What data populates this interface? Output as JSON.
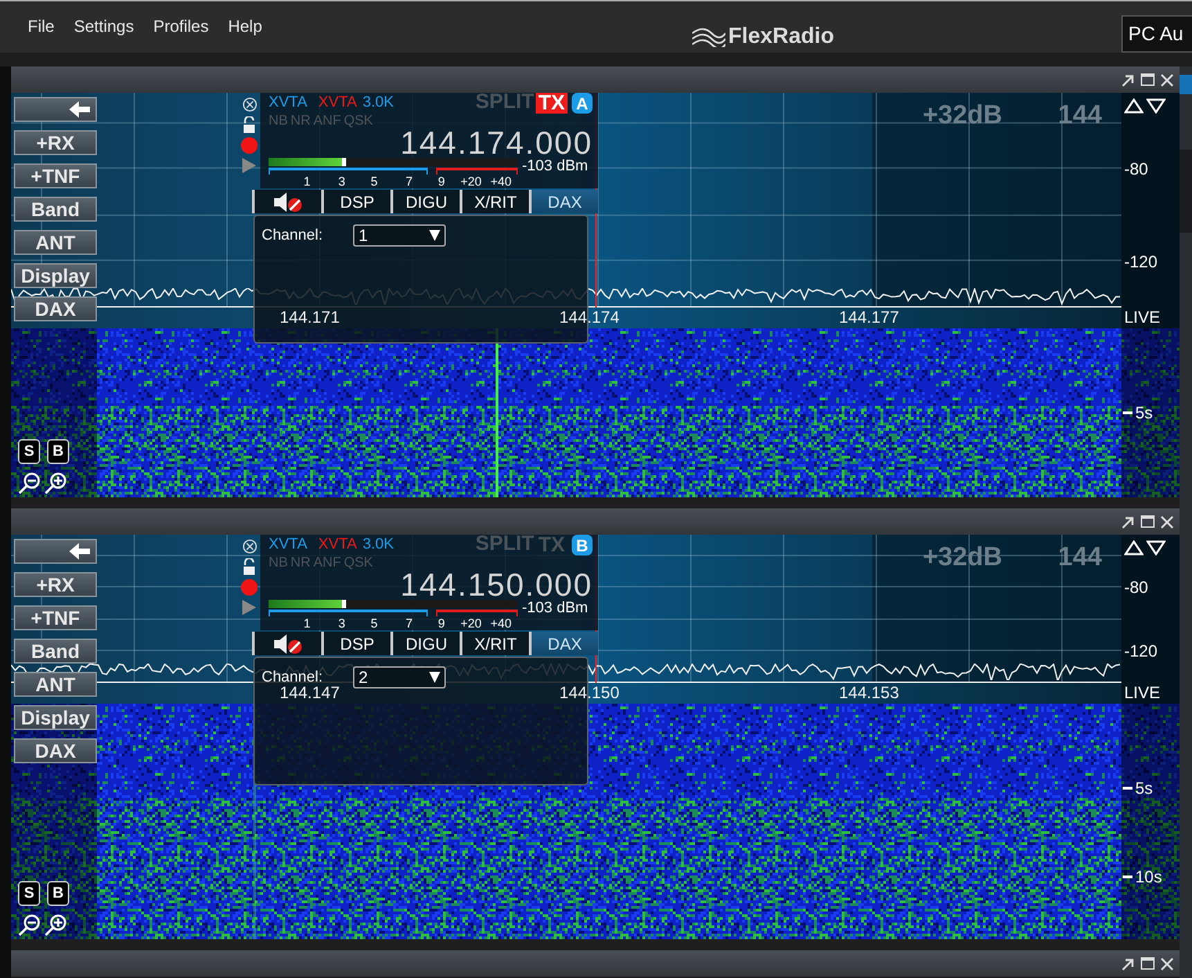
{
  "menu": [
    {
      "label": "File"
    },
    {
      "label": "Settings"
    },
    {
      "label": "Profiles"
    },
    {
      "label": "Help"
    }
  ],
  "logo": "FlexRadio",
  "profile_field": {
    "value": "PC Au"
  },
  "panadapters": [
    {
      "side_buttons": [
        "+RX",
        "+TNF",
        "Band",
        "ANT",
        "Display",
        "DAX"
      ],
      "gain": "+32dB",
      "band": "144",
      "scale": [
        "-80",
        "-120"
      ],
      "live": "LIVE",
      "freq_ticks": [
        "144.171",
        "144.174",
        "144.177"
      ],
      "time_ticks": [
        "5s"
      ],
      "waterfall_buttons": [
        "S",
        "B"
      ],
      "slice": {
        "letter": "A",
        "tx": true,
        "rx_ant": "XVTA",
        "tx_ant": "XVTA",
        "filter": "3.0K",
        "dsp_flags": [
          {
            "label": "NB",
            "on": false
          },
          {
            "label": "NR",
            "on": false
          },
          {
            "label": "ANF",
            "on": false
          },
          {
            "label": "QSK",
            "on": false
          }
        ],
        "split": "SPLIT",
        "tx_label": "TX",
        "frequency": "144.174.000",
        "meter": {
          "level": 0.31,
          "scale_labels": [
            "1",
            "3",
            "5",
            "7",
            "9",
            "+20",
            "+40"
          ],
          "reading": "-103 dBm"
        },
        "tabs": [
          {
            "kind": "mute",
            "selected": false
          },
          {
            "kind": "text",
            "label": "DSP",
            "selected": false
          },
          {
            "kind": "text",
            "label": "DIGU",
            "selected": false
          },
          {
            "kind": "text",
            "label": "X/RIT",
            "selected": false
          },
          {
            "kind": "text",
            "label": "DAX",
            "selected": true
          }
        ],
        "dax": {
          "label": "Channel:",
          "value": "1"
        }
      }
    },
    {
      "side_buttons": [
        "+RX",
        "+TNF",
        "Band",
        "ANT",
        "Display",
        "DAX"
      ],
      "gain": "+32dB",
      "band": "144",
      "scale": [
        "-80",
        "-120"
      ],
      "live": "LIVE",
      "freq_ticks": [
        "144.147",
        "144.150",
        "144.153"
      ],
      "time_ticks": [
        "5s",
        "10s"
      ],
      "waterfall_buttons": [
        "S",
        "B"
      ],
      "slice": {
        "letter": "B",
        "tx": false,
        "rx_ant": "XVTA",
        "tx_ant": "XVTA",
        "filter": "3.0K",
        "dsp_flags": [
          {
            "label": "NB",
            "on": false
          },
          {
            "label": "NR",
            "on": false
          },
          {
            "label": "ANF",
            "on": false
          },
          {
            "label": "QSK",
            "on": false
          }
        ],
        "split": "SPLIT",
        "tx_label": "TX",
        "frequency": "144.150.000",
        "meter": {
          "level": 0.31,
          "scale_labels": [
            "1",
            "3",
            "5",
            "7",
            "9",
            "+20",
            "+40"
          ],
          "reading": "-103 dBm"
        },
        "tabs": [
          {
            "kind": "mute",
            "selected": false
          },
          {
            "kind": "text",
            "label": "DSP",
            "selected": false
          },
          {
            "kind": "text",
            "label": "DIGU",
            "selected": false
          },
          {
            "kind": "text",
            "label": "X/RIT",
            "selected": false
          },
          {
            "kind": "text",
            "label": "DAX",
            "selected": true
          }
        ],
        "dax": {
          "label": "Channel:",
          "value": "2"
        }
      }
    }
  ]
}
